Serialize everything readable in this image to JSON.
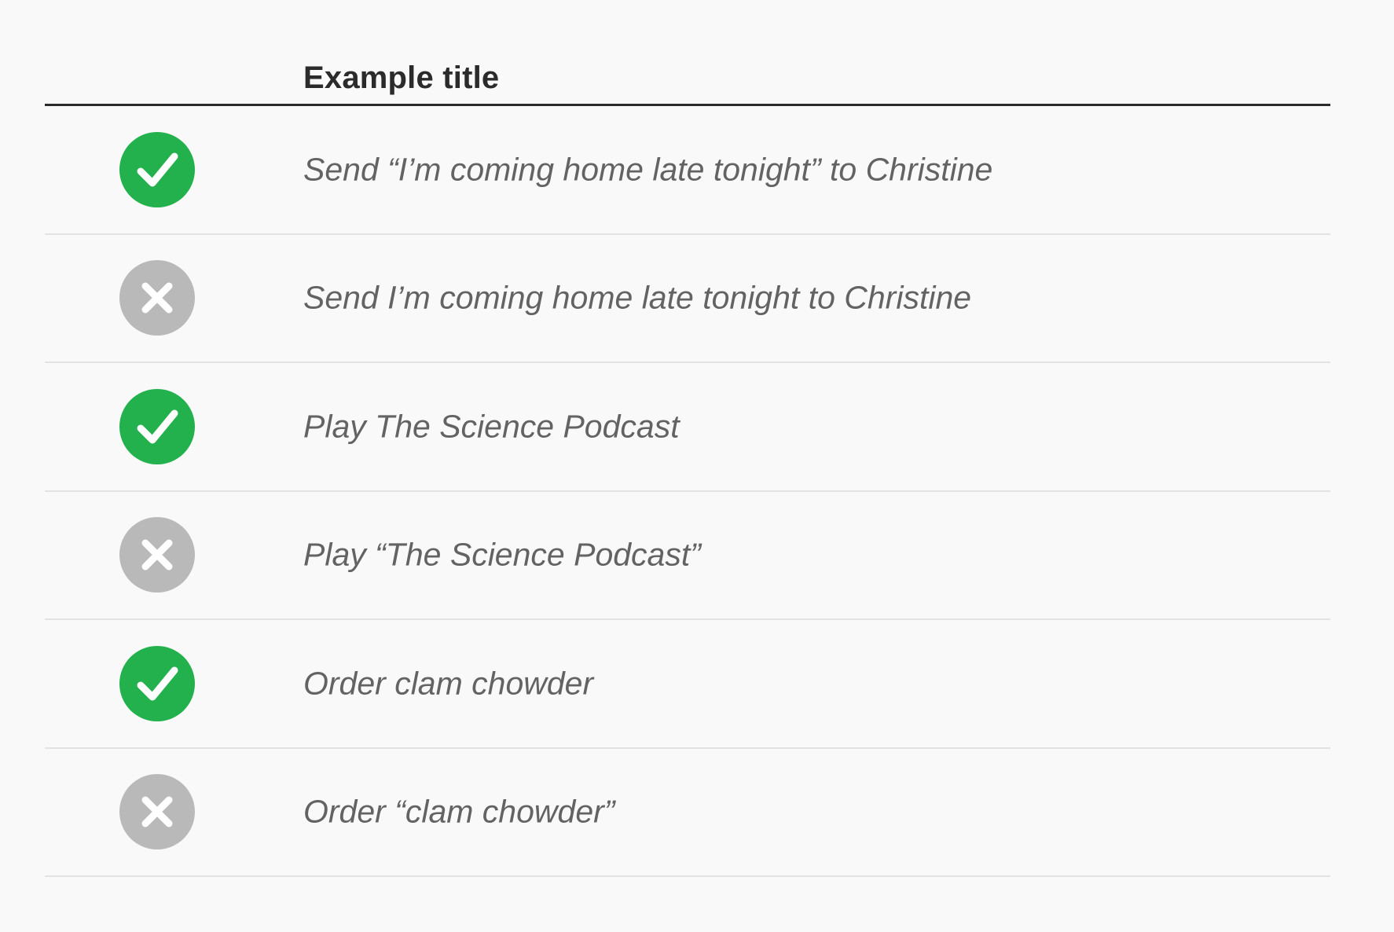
{
  "header": {
    "title": "Example title"
  },
  "colors": {
    "correct": "#22b14c",
    "incorrect": "#b9b9b9",
    "text": "#636363",
    "title": "#2b2b2b"
  },
  "rows": [
    {
      "status": "correct",
      "icon": "checkmark-icon",
      "text": "Send “I’m coming home late tonight” to Christine"
    },
    {
      "status": "incorrect",
      "icon": "x-mark-icon",
      "text": "Send I’m coming home late tonight to Christine"
    },
    {
      "status": "correct",
      "icon": "checkmark-icon",
      "text": "Play The Science Podcast"
    },
    {
      "status": "incorrect",
      "icon": "x-mark-icon",
      "text": "Play “The Science Podcast”"
    },
    {
      "status": "correct",
      "icon": "checkmark-icon",
      "text": "Order clam chowder"
    },
    {
      "status": "incorrect",
      "icon": "x-mark-icon",
      "text": "Order “clam chowder”"
    }
  ]
}
